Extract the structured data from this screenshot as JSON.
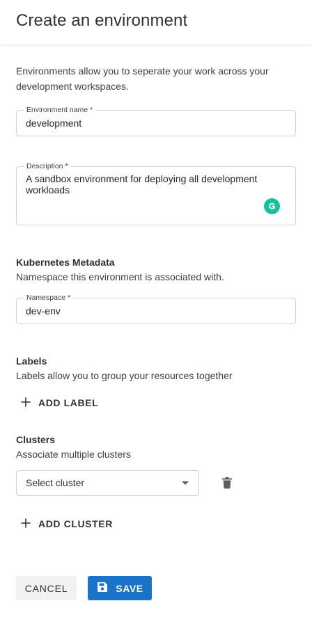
{
  "header": {
    "title": "Create an environment"
  },
  "intro": "Environments allow you to seperate your work across your development workspaces.",
  "form": {
    "name": {
      "label": "Environment name *",
      "value": "development"
    },
    "description": {
      "label": "Description *",
      "value": "A sandbox environment for deploying all development workloads"
    },
    "namespace": {
      "label": "Namespace *",
      "value": "dev-env"
    }
  },
  "kubernetes": {
    "title": "Kubernetes Metadata",
    "subtitle": "Namespace this environment is associated with."
  },
  "labels": {
    "title": "Labels",
    "subtitle": "Labels allow you to group your resources together",
    "add_label": "ADD LABEL"
  },
  "clusters": {
    "title": "Clusters",
    "subtitle": "Associate multiple clusters",
    "select_value": "Select cluster",
    "add_cluster": "ADD CLUSTER"
  },
  "actions": {
    "cancel": "CANCEL",
    "save": "SAVE"
  },
  "icons": {
    "grammarly": "grammarly-icon",
    "plus": "plus-icon",
    "trash": "trash-icon",
    "save": "save-icon",
    "caret": "caret-down-icon"
  },
  "colors": {
    "primary": "#1a73c8",
    "grammarly": "#15c39a",
    "cancel_bg": "#f1f2f3"
  }
}
